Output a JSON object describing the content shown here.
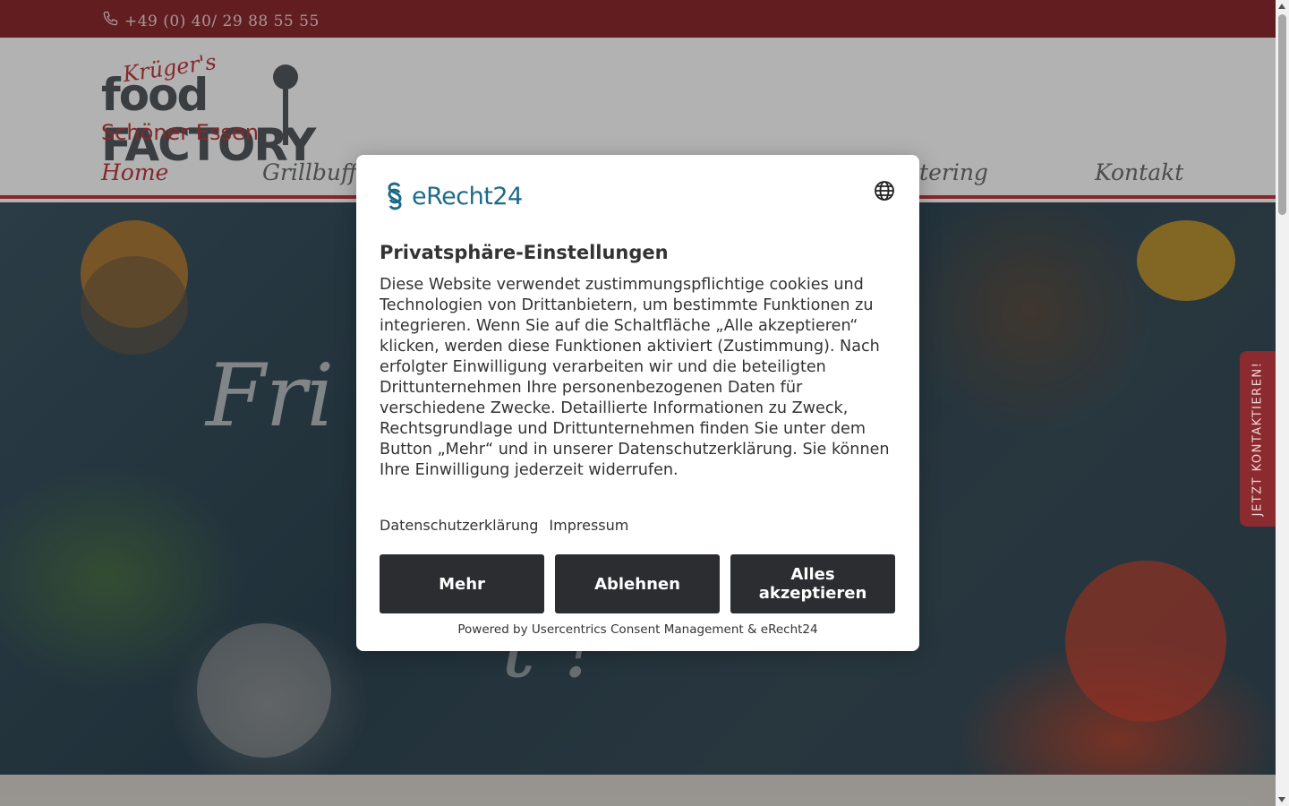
{
  "topbar": {
    "phone": "+49 (0) 40/ 29 88 55 55"
  },
  "logo": {
    "brand_small": "Krüger's",
    "brand_main": "food FACTORY",
    "tagline": "Schöner Essen"
  },
  "nav": {
    "items": [
      {
        "label": "Home",
        "active": true
      },
      {
        "label": "Grillbuffet"
      },
      {
        "label": "Catering"
      },
      {
        "label": "Kontakt"
      }
    ]
  },
  "hero": {
    "headline_visible": "Fri",
    "headline2_visible": "t !"
  },
  "side_tab": {
    "label": "JETZT KONTAKTIEREN!"
  },
  "modal": {
    "brand": "eRecht24",
    "title": "Privatsphäre-Einstellungen",
    "body": "Diese Website verwendet zustimmungspflichtige cookies und Technologien von Drittanbietern, um bestimmte Funktionen zu integrieren. Wenn Sie auf die Schaltfläche „Alle akzeptieren“ klicken, werden diese Funktionen aktiviert (Zustimmung). Nach erfolgter Einwilligung verarbeiten wir und die beteiligten Drittunternehmen Ihre personenbezogenen Daten für verschiedene Zwecke. Detaillierte Informationen zu Zweck, Rechtsgrundlage und Drittunternehmen finden Sie unter dem Button „Mehr“ und in unserer Datenschutzerklärung. Sie können Ihre Einwilligung jederzeit widerrufen.",
    "links": {
      "privacy": "Datenschutzerklärung",
      "imprint": "Impressum"
    },
    "buttons": {
      "more": "Mehr",
      "decline": "Ablehnen",
      "accept_all": "Alles akzeptieren"
    },
    "powered_by": "Powered by Usercentrics Consent Management & eRecht24"
  },
  "colors": {
    "brand_red": "#8b2a2f",
    "accent_red": "#c0383e",
    "button_dark": "#2b2d30",
    "erecht_blue": "#1c6b8a"
  }
}
